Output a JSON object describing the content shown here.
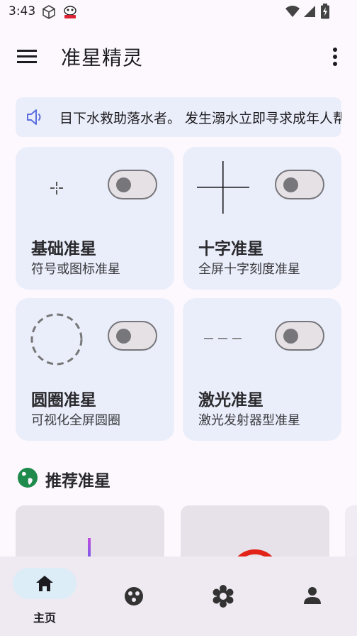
{
  "status": {
    "time": "3:43",
    "icons": [
      "cube-icon",
      "app-badge-icon",
      "wifi-icon",
      "signal-icon",
      "battery-charging-icon"
    ]
  },
  "appbar": {
    "title": "准星精灵",
    "menu_icon": "hamburger-icon",
    "more_icon": "more-vert-icon"
  },
  "notice": {
    "icon": "speaker-icon",
    "text": "目下水救助落水者。 发生溺水立即寻求成年人帮"
  },
  "cards": [
    {
      "title": "基础准星",
      "subtitle": "符号或图标准星",
      "enabled": false,
      "icon": "basic-crosshair-icon"
    },
    {
      "title": "十字准星",
      "subtitle": "全屏十字刻度准星",
      "enabled": false,
      "icon": "cross-crosshair-icon"
    },
    {
      "title": "圆圈准星",
      "subtitle": "可视化全屏圆圈",
      "enabled": false,
      "icon": "circle-crosshair-icon"
    },
    {
      "title": "激光准星",
      "subtitle": "激光发射器型准星",
      "enabled": false,
      "icon": "laser-crosshair-icon"
    }
  ],
  "recommended": {
    "title": "推荐准星",
    "icon": "globe-icon"
  },
  "bottom_nav": [
    {
      "label": "主页",
      "icon": "home-icon",
      "active": true
    },
    {
      "label": "",
      "icon": "palette-icon",
      "active": false
    },
    {
      "label": "",
      "icon": "settings-gear-icon",
      "active": false
    },
    {
      "label": "",
      "icon": "person-icon",
      "active": false
    }
  ],
  "colors": {
    "background": "#fdf8fd",
    "card": "#eaeefa",
    "accent_green": "#1e8a4c",
    "nav_active": "#dcedf8"
  }
}
